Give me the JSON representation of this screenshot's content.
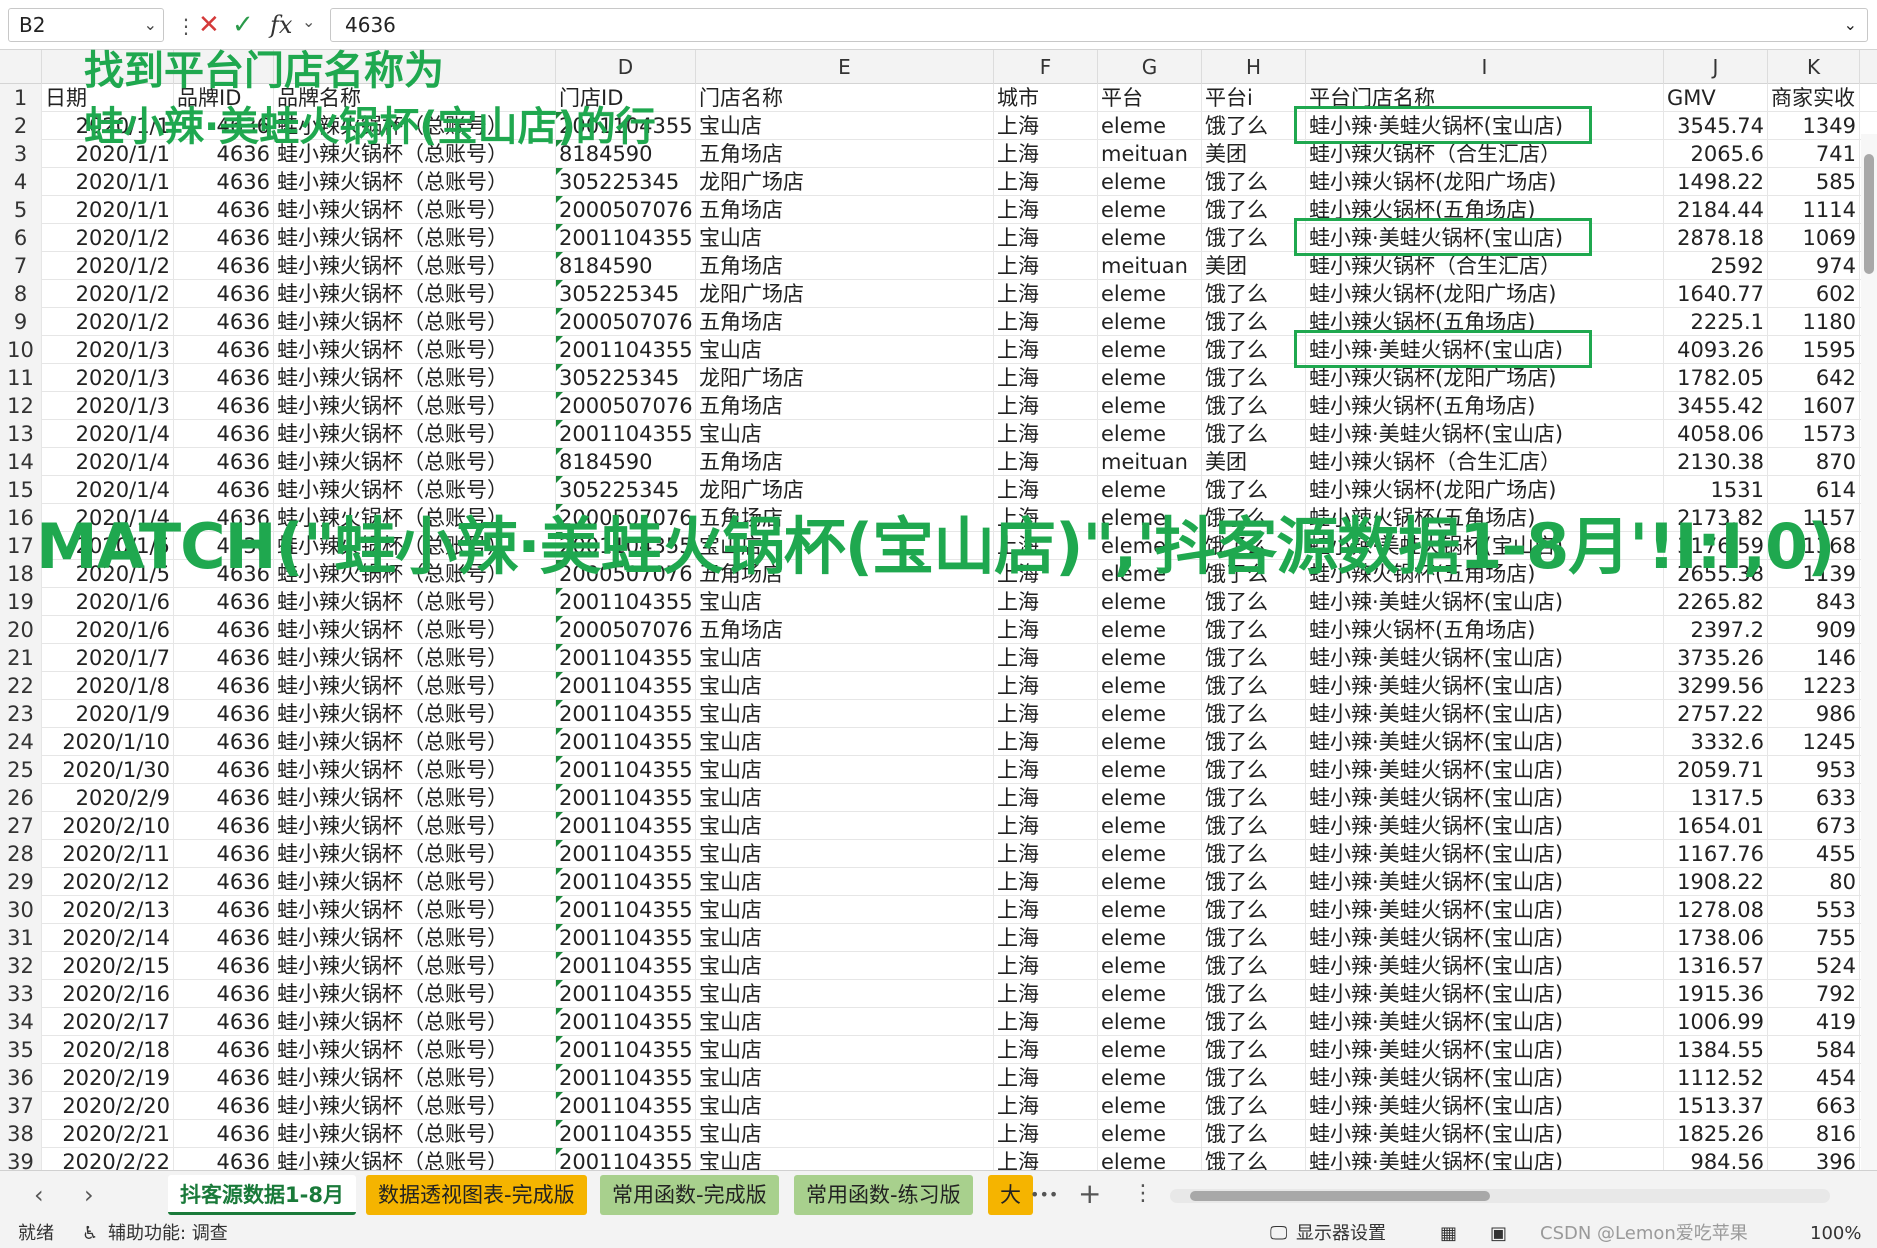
{
  "formula_bar": {
    "name_box": "B2",
    "cancel_icon": "✕",
    "confirm_icon": "✓",
    "fx_label": "fx",
    "formula": "4636"
  },
  "columns": [
    {
      "letter": "",
      "key": "rn"
    },
    {
      "letter": "",
      "key": "date"
    },
    {
      "letter": "",
      "key": "brand_id"
    },
    {
      "letter": "",
      "key": "brand_name"
    },
    {
      "letter": "D",
      "key": "store_id"
    },
    {
      "letter": "E",
      "key": "store_name"
    },
    {
      "letter": "F",
      "key": "city"
    },
    {
      "letter": "G",
      "key": "platform"
    },
    {
      "letter": "H",
      "key": "platform_i"
    },
    {
      "letter": "I",
      "key": "platform_store"
    },
    {
      "letter": "J",
      "key": "gmv"
    },
    {
      "letter": "K",
      "key": "actual"
    }
  ],
  "header_row": {
    "rn": "1",
    "date": "日期",
    "brand_id": "品牌ID",
    "brand_name": "品牌名称",
    "store_id": "门店ID",
    "store_name": "门店名称",
    "city": "城市",
    "platform": "平台",
    "platform_i": "平台i",
    "platform_store": "平台门店名称",
    "gmv": "GMV",
    "actual": "商家实收"
  },
  "rows": [
    {
      "rn": "2",
      "date": "2020/1/1",
      "brand_id": "4636",
      "brand_name": "蛙小辣火锅杯（总账号）",
      "store_id": "2001104355",
      "store_name": "宝山店",
      "city": "上海",
      "platform": "eleme",
      "platform_i": "饿了么",
      "platform_store": "蛙小辣·美蛙火锅杯(宝山店)",
      "gmv": "3545.74",
      "actual": "1349"
    },
    {
      "rn": "3",
      "date": "2020/1/1",
      "brand_id": "4636",
      "brand_name": "蛙小辣火锅杯（总账号）",
      "store_id": "8184590",
      "store_name": "五角场店",
      "city": "上海",
      "platform": "meituan",
      "platform_i": "美团",
      "platform_store": "蛙小辣火锅杯（合生汇店）",
      "gmv": "2065.6",
      "actual": "741"
    },
    {
      "rn": "4",
      "date": "2020/1/1",
      "brand_id": "4636",
      "brand_name": "蛙小辣火锅杯（总账号）",
      "store_id": "305225345",
      "store_name": "龙阳广场店",
      "city": "上海",
      "platform": "eleme",
      "platform_i": "饿了么",
      "platform_store": "蛙小辣火锅杯(龙阳广场店)",
      "gmv": "1498.22",
      "actual": "585"
    },
    {
      "rn": "5",
      "date": "2020/1/1",
      "brand_id": "4636",
      "brand_name": "蛙小辣火锅杯（总账号）",
      "store_id": "2000507076",
      "store_name": "五角场店",
      "city": "上海",
      "platform": "eleme",
      "platform_i": "饿了么",
      "platform_store": "蛙小辣火锅杯(五角场店)",
      "gmv": "2184.44",
      "actual": "1114"
    },
    {
      "rn": "6",
      "date": "2020/1/2",
      "brand_id": "4636",
      "brand_name": "蛙小辣火锅杯（总账号）",
      "store_id": "2001104355",
      "store_name": "宝山店",
      "city": "上海",
      "platform": "eleme",
      "platform_i": "饿了么",
      "platform_store": "蛙小辣·美蛙火锅杯(宝山店)",
      "gmv": "2878.18",
      "actual": "1069"
    },
    {
      "rn": "7",
      "date": "2020/1/2",
      "brand_id": "4636",
      "brand_name": "蛙小辣火锅杯（总账号）",
      "store_id": "8184590",
      "store_name": "五角场店",
      "city": "上海",
      "platform": "meituan",
      "platform_i": "美团",
      "platform_store": "蛙小辣火锅杯（合生汇店）",
      "gmv": "2592",
      "actual": "974"
    },
    {
      "rn": "8",
      "date": "2020/1/2",
      "brand_id": "4636",
      "brand_name": "蛙小辣火锅杯（总账号）",
      "store_id": "305225345",
      "store_name": "龙阳广场店",
      "city": "上海",
      "platform": "eleme",
      "platform_i": "饿了么",
      "platform_store": "蛙小辣火锅杯(龙阳广场店)",
      "gmv": "1640.77",
      "actual": "602"
    },
    {
      "rn": "9",
      "date": "2020/1/2",
      "brand_id": "4636",
      "brand_name": "蛙小辣火锅杯（总账号）",
      "store_id": "2000507076",
      "store_name": "五角场店",
      "city": "上海",
      "platform": "eleme",
      "platform_i": "饿了么",
      "platform_store": "蛙小辣火锅杯(五角场店)",
      "gmv": "2225.1",
      "actual": "1180"
    },
    {
      "rn": "10",
      "date": "2020/1/3",
      "brand_id": "4636",
      "brand_name": "蛙小辣火锅杯（总账号）",
      "store_id": "2001104355",
      "store_name": "宝山店",
      "city": "上海",
      "platform": "eleme",
      "platform_i": "饿了么",
      "platform_store": "蛙小辣·美蛙火锅杯(宝山店)",
      "gmv": "4093.26",
      "actual": "1595"
    },
    {
      "rn": "11",
      "date": "2020/1/3",
      "brand_id": "4636",
      "brand_name": "蛙小辣火锅杯（总账号）",
      "store_id": "305225345",
      "store_name": "龙阳广场店",
      "city": "上海",
      "platform": "eleme",
      "platform_i": "饿了么",
      "platform_store": "蛙小辣火锅杯(龙阳广场店)",
      "gmv": "1782.05",
      "actual": "642"
    },
    {
      "rn": "12",
      "date": "2020/1/3",
      "brand_id": "4636",
      "brand_name": "蛙小辣火锅杯（总账号）",
      "store_id": "2000507076",
      "store_name": "五角场店",
      "city": "上海",
      "platform": "eleme",
      "platform_i": "饿了么",
      "platform_store": "蛙小辣火锅杯(五角场店)",
      "gmv": "3455.42",
      "actual": "1607"
    },
    {
      "rn": "13",
      "date": "2020/1/4",
      "brand_id": "4636",
      "brand_name": "蛙小辣火锅杯（总账号）",
      "store_id": "2001104355",
      "store_name": "宝山店",
      "city": "上海",
      "platform": "eleme",
      "platform_i": "饿了么",
      "platform_store": "蛙小辣·美蛙火锅杯(宝山店)",
      "gmv": "4058.06",
      "actual": "1573"
    },
    {
      "rn": "14",
      "date": "2020/1/4",
      "brand_id": "4636",
      "brand_name": "蛙小辣火锅杯（总账号）",
      "store_id": "8184590",
      "store_name": "五角场店",
      "city": "上海",
      "platform": "meituan",
      "platform_i": "美团",
      "platform_store": "蛙小辣火锅杯（合生汇店）",
      "gmv": "2130.38",
      "actual": "870"
    },
    {
      "rn": "15",
      "date": "2020/1/4",
      "brand_id": "4636",
      "brand_name": "蛙小辣火锅杯（总账号）",
      "store_id": "305225345",
      "store_name": "龙阳广场店",
      "city": "上海",
      "platform": "eleme",
      "platform_i": "饿了么",
      "platform_store": "蛙小辣火锅杯(龙阳广场店)",
      "gmv": "1531",
      "actual": "614"
    },
    {
      "rn": "16",
      "date": "2020/1/4",
      "brand_id": "4636",
      "brand_name": "蛙小辣火锅杯（总账号）",
      "store_id": "2000507076",
      "store_name": "五角场店",
      "city": "上海",
      "platform": "eleme",
      "platform_i": "饿了么",
      "platform_store": "蛙小辣火锅杯(五角场店)",
      "gmv": "2173.82",
      "actual": "1157"
    },
    {
      "rn": "17",
      "date": "2020/1/5",
      "brand_id": "4636",
      "brand_name": "蛙小辣火锅杯（总账号）",
      "store_id": "2001104355",
      "store_name": "宝山店",
      "city": "上海",
      "platform": "eleme",
      "platform_i": "饿了么",
      "platform_store": "蛙小辣·美蛙火锅杯(宝山店)",
      "gmv": "3176.59",
      "actual": "1368"
    },
    {
      "rn": "18",
      "date": "2020/1/5",
      "brand_id": "4636",
      "brand_name": "蛙小辣火锅杯（总账号）",
      "store_id": "2000507076",
      "store_name": "五角场店",
      "city": "上海",
      "platform": "eleme",
      "platform_i": "饿了么",
      "platform_store": "蛙小辣火锅杯(五角场店)",
      "gmv": "2655.38",
      "actual": "1139"
    },
    {
      "rn": "19",
      "date": "2020/1/6",
      "brand_id": "4636",
      "brand_name": "蛙小辣火锅杯（总账号）",
      "store_id": "2001104355",
      "store_name": "宝山店",
      "city": "上海",
      "platform": "eleme",
      "platform_i": "饿了么",
      "platform_store": "蛙小辣·美蛙火锅杯(宝山店)",
      "gmv": "2265.82",
      "actual": "843"
    },
    {
      "rn": "20",
      "date": "2020/1/6",
      "brand_id": "4636",
      "brand_name": "蛙小辣火锅杯（总账号）",
      "store_id": "2000507076",
      "store_name": "五角场店",
      "city": "上海",
      "platform": "eleme",
      "platform_i": "饿了么",
      "platform_store": "蛙小辣火锅杯(五角场店)",
      "gmv": "2397.2",
      "actual": "909"
    },
    {
      "rn": "21",
      "date": "2020/1/7",
      "brand_id": "4636",
      "brand_name": "蛙小辣火锅杯（总账号）",
      "store_id": "2001104355",
      "store_name": "宝山店",
      "city": "上海",
      "platform": "eleme",
      "platform_i": "饿了么",
      "platform_store": "蛙小辣·美蛙火锅杯(宝山店)",
      "gmv": "3735.26",
      "actual": "146"
    },
    {
      "rn": "22",
      "date": "2020/1/8",
      "brand_id": "4636",
      "brand_name": "蛙小辣火锅杯（总账号）",
      "store_id": "2001104355",
      "store_name": "宝山店",
      "city": "上海",
      "platform": "eleme",
      "platform_i": "饿了么",
      "platform_store": "蛙小辣·美蛙火锅杯(宝山店)",
      "gmv": "3299.56",
      "actual": "1223"
    },
    {
      "rn": "23",
      "date": "2020/1/9",
      "brand_id": "4636",
      "brand_name": "蛙小辣火锅杯（总账号）",
      "store_id": "2001104355",
      "store_name": "宝山店",
      "city": "上海",
      "platform": "eleme",
      "platform_i": "饿了么",
      "platform_store": "蛙小辣·美蛙火锅杯(宝山店)",
      "gmv": "2757.22",
      "actual": "986"
    },
    {
      "rn": "24",
      "date": "2020/1/10",
      "brand_id": "4636",
      "brand_name": "蛙小辣火锅杯（总账号）",
      "store_id": "2001104355",
      "store_name": "宝山店",
      "city": "上海",
      "platform": "eleme",
      "platform_i": "饿了么",
      "platform_store": "蛙小辣·美蛙火锅杯(宝山店)",
      "gmv": "3332.6",
      "actual": "1245"
    },
    {
      "rn": "25",
      "date": "2020/1/30",
      "brand_id": "4636",
      "brand_name": "蛙小辣火锅杯（总账号）",
      "store_id": "2001104355",
      "store_name": "宝山店",
      "city": "上海",
      "platform": "eleme",
      "platform_i": "饿了么",
      "platform_store": "蛙小辣·美蛙火锅杯(宝山店)",
      "gmv": "2059.71",
      "actual": "953"
    },
    {
      "rn": "26",
      "date": "2020/2/9",
      "brand_id": "4636",
      "brand_name": "蛙小辣火锅杯（总账号）",
      "store_id": "2001104355",
      "store_name": "宝山店",
      "city": "上海",
      "platform": "eleme",
      "platform_i": "饿了么",
      "platform_store": "蛙小辣·美蛙火锅杯(宝山店)",
      "gmv": "1317.5",
      "actual": "633"
    },
    {
      "rn": "27",
      "date": "2020/2/10",
      "brand_id": "4636",
      "brand_name": "蛙小辣火锅杯（总账号）",
      "store_id": "2001104355",
      "store_name": "宝山店",
      "city": "上海",
      "platform": "eleme",
      "platform_i": "饿了么",
      "platform_store": "蛙小辣·美蛙火锅杯(宝山店)",
      "gmv": "1654.01",
      "actual": "673"
    },
    {
      "rn": "28",
      "date": "2020/2/11",
      "brand_id": "4636",
      "brand_name": "蛙小辣火锅杯（总账号）",
      "store_id": "2001104355",
      "store_name": "宝山店",
      "city": "上海",
      "platform": "eleme",
      "platform_i": "饿了么",
      "platform_store": "蛙小辣·美蛙火锅杯(宝山店)",
      "gmv": "1167.76",
      "actual": "455"
    },
    {
      "rn": "29",
      "date": "2020/2/12",
      "brand_id": "4636",
      "brand_name": "蛙小辣火锅杯（总账号）",
      "store_id": "2001104355",
      "store_name": "宝山店",
      "city": "上海",
      "platform": "eleme",
      "platform_i": "饿了么",
      "platform_store": "蛙小辣·美蛙火锅杯(宝山店)",
      "gmv": "1908.22",
      "actual": "80"
    },
    {
      "rn": "30",
      "date": "2020/2/13",
      "brand_id": "4636",
      "brand_name": "蛙小辣火锅杯（总账号）",
      "store_id": "2001104355",
      "store_name": "宝山店",
      "city": "上海",
      "platform": "eleme",
      "platform_i": "饿了么",
      "platform_store": "蛙小辣·美蛙火锅杯(宝山店)",
      "gmv": "1278.08",
      "actual": "553"
    },
    {
      "rn": "31",
      "date": "2020/2/14",
      "brand_id": "4636",
      "brand_name": "蛙小辣火锅杯（总账号）",
      "store_id": "2001104355",
      "store_name": "宝山店",
      "city": "上海",
      "platform": "eleme",
      "platform_i": "饿了么",
      "platform_store": "蛙小辣·美蛙火锅杯(宝山店)",
      "gmv": "1738.06",
      "actual": "755"
    },
    {
      "rn": "32",
      "date": "2020/2/15",
      "brand_id": "4636",
      "brand_name": "蛙小辣火锅杯（总账号）",
      "store_id": "2001104355",
      "store_name": "宝山店",
      "city": "上海",
      "platform": "eleme",
      "platform_i": "饿了么",
      "platform_store": "蛙小辣·美蛙火锅杯(宝山店)",
      "gmv": "1316.57",
      "actual": "524"
    },
    {
      "rn": "33",
      "date": "2020/2/16",
      "brand_id": "4636",
      "brand_name": "蛙小辣火锅杯（总账号）",
      "store_id": "2001104355",
      "store_name": "宝山店",
      "city": "上海",
      "platform": "eleme",
      "platform_i": "饿了么",
      "platform_store": "蛙小辣·美蛙火锅杯(宝山店)",
      "gmv": "1915.36",
      "actual": "792"
    },
    {
      "rn": "34",
      "date": "2020/2/17",
      "brand_id": "4636",
      "brand_name": "蛙小辣火锅杯（总账号）",
      "store_id": "2001104355",
      "store_name": "宝山店",
      "city": "上海",
      "platform": "eleme",
      "platform_i": "饿了么",
      "platform_store": "蛙小辣·美蛙火锅杯(宝山店)",
      "gmv": "1006.99",
      "actual": "419"
    },
    {
      "rn": "35",
      "date": "2020/2/18",
      "brand_id": "4636",
      "brand_name": "蛙小辣火锅杯（总账号）",
      "store_id": "2001104355",
      "store_name": "宝山店",
      "city": "上海",
      "platform": "eleme",
      "platform_i": "饿了么",
      "platform_store": "蛙小辣·美蛙火锅杯(宝山店)",
      "gmv": "1384.55",
      "actual": "584"
    },
    {
      "rn": "36",
      "date": "2020/2/19",
      "brand_id": "4636",
      "brand_name": "蛙小辣火锅杯（总账号）",
      "store_id": "2001104355",
      "store_name": "宝山店",
      "city": "上海",
      "platform": "eleme",
      "platform_i": "饿了么",
      "platform_store": "蛙小辣·美蛙火锅杯(宝山店)",
      "gmv": "1112.52",
      "actual": "454"
    },
    {
      "rn": "37",
      "date": "2020/2/20",
      "brand_id": "4636",
      "brand_name": "蛙小辣火锅杯（总账号）",
      "store_id": "2001104355",
      "store_name": "宝山店",
      "city": "上海",
      "platform": "eleme",
      "platform_i": "饿了么",
      "platform_store": "蛙小辣·美蛙火锅杯(宝山店)",
      "gmv": "1513.37",
      "actual": "663"
    },
    {
      "rn": "38",
      "date": "2020/2/21",
      "brand_id": "4636",
      "brand_name": "蛙小辣火锅杯（总账号）",
      "store_id": "2001104355",
      "store_name": "宝山店",
      "city": "上海",
      "platform": "eleme",
      "platform_i": "饿了么",
      "platform_store": "蛙小辣·美蛙火锅杯(宝山店)",
      "gmv": "1825.26",
      "actual": "816"
    },
    {
      "rn": "39",
      "date": "2020/2/22",
      "brand_id": "4636",
      "brand_name": "蛙小辣火锅杯（总账号）",
      "store_id": "2001104355",
      "store_name": "宝山店",
      "city": "上海",
      "platform": "eleme",
      "platform_i": "饿了么",
      "platform_store": "蛙小辣·美蛙火锅杯(宝山店)",
      "gmv": "984.56",
      "actual": "396"
    }
  ],
  "highlighted_rows": [
    "2",
    "6",
    "10"
  ],
  "overlay": {
    "title_line1": "找到平台门店名称为",
    "title_line2": "蛙小辣·美蛙火锅杯(宝山店)的行",
    "formula": "MATCH(\"蛙小辣·美蛙火锅杯(宝山店)\",'抖客源数据1-8月'!I:I,0)"
  },
  "tabs": {
    "prev_icon": "‹",
    "next_icon": "›",
    "items": [
      {
        "label": "抖客源数据1-8月",
        "bg": "#ffffff",
        "color": "#1a7a3a"
      },
      {
        "label": "数据透视图表-完成版",
        "bg": "#f5b400",
        "color": "#222"
      },
      {
        "label": "常用函数-完成版",
        "bg": "#a8d08d",
        "color": "#222"
      },
      {
        "label": "常用函数-练习版",
        "bg": "#a8d08d",
        "color": "#222"
      },
      {
        "label": "大",
        "bg": "#f5b400",
        "color": "#222"
      }
    ],
    "more_icon": "•••",
    "add_icon": "+",
    "options_icon": "⋮"
  },
  "status": {
    "ready": "就绪",
    "accessibility": "辅助功能: 调查",
    "display_settings": "显示器设置",
    "zoom": "100%",
    "watermark": "CSDN @Lemon爱吃苹果"
  }
}
